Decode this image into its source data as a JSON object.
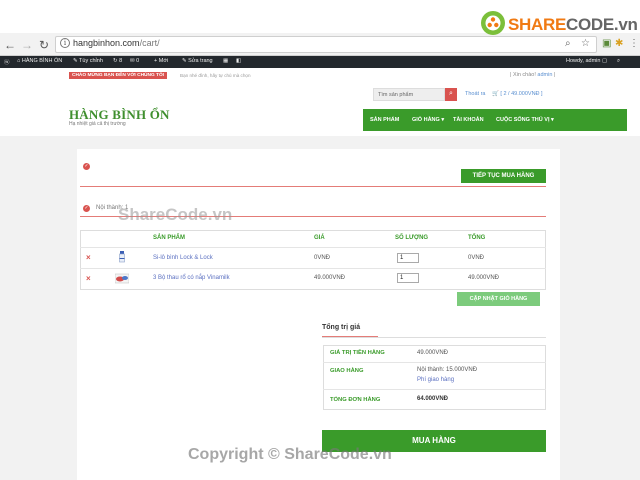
{
  "browser": {
    "url_host": "hangbinhon.com",
    "url_path": "/cart/"
  },
  "admin_bar": {
    "site_name": "HÀNG BÌNH ỔN",
    "customize": "Tùy chỉnh",
    "updates": "8",
    "comments": "0",
    "new": "+ Mới",
    "edit_page": "Sửa trang",
    "howdy": "Howdy, admin"
  },
  "header": {
    "promo": "CHÀO MỪNG BẠN ĐẾN VỚI CHÚNG TÔI",
    "promo_sub": "Bạn nhé đình, hãy tự chủ mà chọn",
    "welcome_prefix": "| Xin chào! ",
    "welcome_user": "admin",
    "welcome_suffix": " |",
    "logo": "HÀNG BÌNH ỔN",
    "tagline": "Hạ nhiệt giá cả thị trường",
    "search_placeholder": "Tìm sản phẩm",
    "account_link": "Thoát ra",
    "mini_cart": "[ 2 / 49.000VNĐ ]",
    "nav": [
      "SẢN PHẨM",
      "GIỎ HÀNG ▾",
      "TÀI KHOẢN",
      "CUỘC SỐNG THÚ VỊ ▾"
    ]
  },
  "cart": {
    "continue_button": "TIẾP TỤC MUA HÀNG",
    "notice2": "Nội thành: 1",
    "columns": [
      "SẢN PHẨM",
      "GIÁ",
      "SỐ LƯỢNG",
      "TỔNG"
    ],
    "items": [
      {
        "name": "Si-lô bình Lock & Lock",
        "price": "0VNĐ",
        "qty": "1",
        "total": "0VNĐ"
      },
      {
        "name": "3 Bộ thau rổ có nắp Vinamilk",
        "price": "49.000VNĐ",
        "qty": "1",
        "total": "49.000VNĐ"
      }
    ],
    "update_button": "CẬP NHẬT GIỎ HÀNG"
  },
  "totals": {
    "title": "Tổng trị giá",
    "subtotal_label": "GIÁ TRỊ TIỀN HÀNG",
    "subtotal_value": "49.000VNĐ",
    "shipping_label": "GIAO HÀNG",
    "shipping_value": "Nội thành: 15.000VNĐ",
    "shipping_link": "Phí giao hàng",
    "total_label": "TỔNG ĐƠN HÀNG",
    "total_value": "64.000VNĐ",
    "checkout_button": "MUA HÀNG"
  },
  "watermarks": {
    "logo_share": "SHARE",
    "logo_code": "CODE.vn",
    "middle": "ShareCode.vn",
    "bottom": "Copyright © ShareCode.vn"
  },
  "colors": {
    "brand_green": "#3a9b2a",
    "alert_red": "#d9534f",
    "link_blue": "#5a6fc0"
  }
}
